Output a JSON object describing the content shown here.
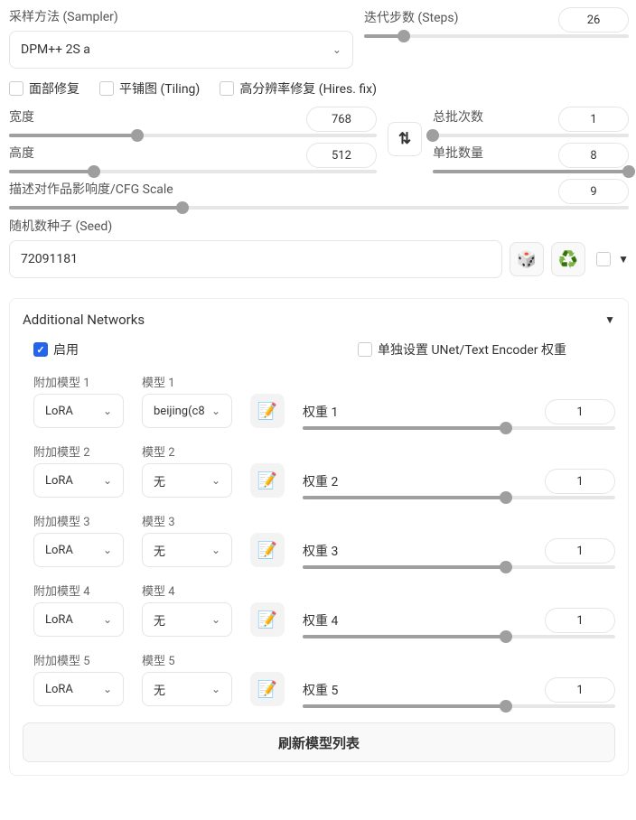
{
  "sampler": {
    "label": "采样方法 (Sampler)",
    "value": "DPM++ 2S a"
  },
  "steps": {
    "label": "迭代步数 (Steps)",
    "value": "26",
    "fill_pct": 15
  },
  "checks": {
    "face_restore": "面部修复",
    "tiling": "平铺图 (Tiling)",
    "hires_fix": "高分辨率修复 (Hires. fix)"
  },
  "width": {
    "label": "宽度",
    "value": "768",
    "fill_pct": 35
  },
  "height": {
    "label": "高度",
    "value": "512",
    "fill_pct": 23
  },
  "batch_count": {
    "label": "总批次数",
    "value": "1",
    "fill_pct": 0
  },
  "batch_size": {
    "label": "单批数量",
    "value": "8",
    "fill_pct": 100
  },
  "cfg": {
    "label": "描述对作品影响度/CFG Scale",
    "value": "9",
    "fill_pct": 28
  },
  "seed": {
    "label": "随机数种子 (Seed)",
    "value": "72091181"
  },
  "panel_title": "Additional Networks",
  "enable": {
    "label": "启用",
    "checked": true
  },
  "separate": {
    "label": "单独设置 UNet/Text Encoder 权重",
    "checked": false
  },
  "networks": [
    {
      "addon_label": "附加模型 1",
      "addon_value": "LoRA",
      "model_label": "模型 1",
      "model_value": "beijing(c8",
      "weight_label": "权重 1",
      "weight_value": "1",
      "fill_pct": 65
    },
    {
      "addon_label": "附加模型 2",
      "addon_value": "LoRA",
      "model_label": "模型 2",
      "model_value": "无",
      "weight_label": "权重 2",
      "weight_value": "1",
      "fill_pct": 65
    },
    {
      "addon_label": "附加模型 3",
      "addon_value": "LoRA",
      "model_label": "模型 3",
      "model_value": "无",
      "weight_label": "权重 3",
      "weight_value": "1",
      "fill_pct": 65
    },
    {
      "addon_label": "附加模型 4",
      "addon_value": "LoRA",
      "model_label": "模型 4",
      "model_value": "无",
      "weight_label": "权重 4",
      "weight_value": "1",
      "fill_pct": 65
    },
    {
      "addon_label": "附加模型 5",
      "addon_value": "LoRA",
      "model_label": "模型 5",
      "model_value": "无",
      "weight_label": "权重 5",
      "weight_value": "1",
      "fill_pct": 65
    }
  ],
  "refresh": "刷新模型列表",
  "icons": {
    "swap": "⇅",
    "dice": "🎲",
    "recycle": "♻️",
    "edit": "📝"
  }
}
